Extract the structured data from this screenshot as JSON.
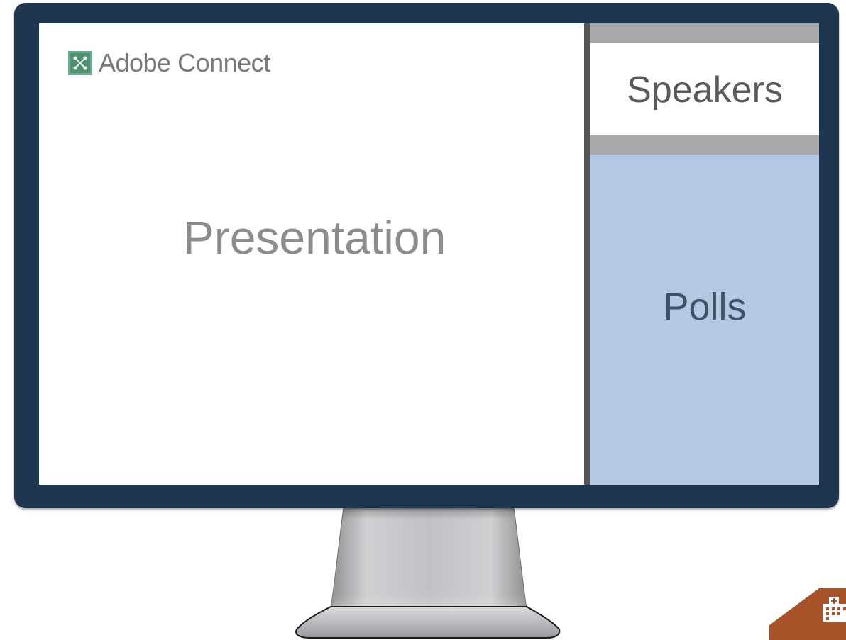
{
  "brand": {
    "name": "Adobe Connect",
    "logo_icon": "adobe-connect-logo-icon",
    "logo_color": "#6dab8f"
  },
  "pods": {
    "presentation": {
      "label": "Presentation"
    },
    "speakers": {
      "label": "Speakers"
    },
    "polls": {
      "label": "Polls"
    }
  },
  "colors": {
    "bezel": "#1e3650",
    "polls_background": "#b4c8e2",
    "pod_header_bar": "#a8a8a8",
    "corner_badge": "#a9532a"
  },
  "corner_badge": {
    "icon": "building-icon"
  }
}
